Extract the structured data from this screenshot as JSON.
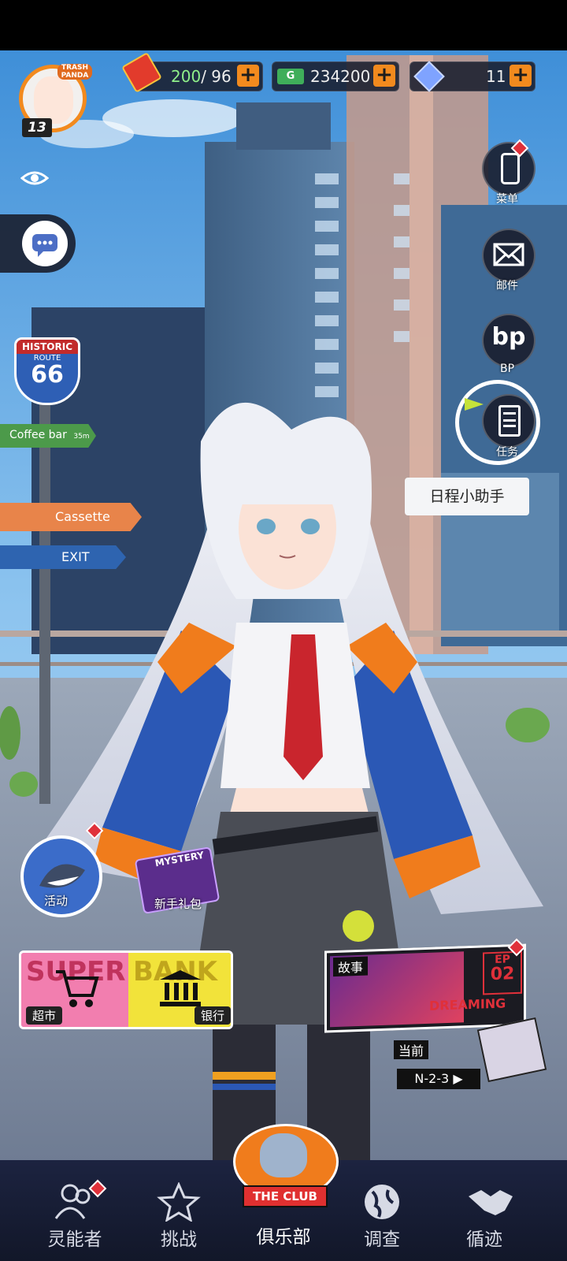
{
  "player": {
    "level": "13",
    "avatar_badge": "TRASH PANDA"
  },
  "resources": {
    "stamina_current": "200",
    "stamina_max": "96",
    "cash": "234200",
    "crystals": "11",
    "cash_icon_text": "G"
  },
  "side_menu": {
    "menu_label": "菜单",
    "mail_label": "邮件",
    "bp_label": "BP",
    "bp_icon_text": "bp",
    "tasks_label": "任务",
    "tooltip": "日程小助手"
  },
  "scenery": {
    "route_top": "HISTORIC",
    "route_mid": "ROUTE",
    "route_num": "66",
    "sign_coffee": "Coffee bar",
    "sign_coffee_sub": "35m",
    "sign_cassette": "Cassette",
    "sign_exit": "EXIT"
  },
  "events": {
    "activity_label": "活动",
    "newbie_pack_label": "新手礼包",
    "newbie_pack_tag": "MYSTERY",
    "supermarket_label": "超市",
    "bank_label": "银行",
    "supermarket_deco": "SUPER",
    "bank_deco": "BANK",
    "story_label": "故事",
    "story_episode": "EP",
    "story_episode_num": "02",
    "story_deco": "DREAMING",
    "current_label": "当前",
    "current_stage": "N-2-3"
  },
  "nav": {
    "items": [
      {
        "label": "灵能者"
      },
      {
        "label": "挑战"
      },
      {
        "label": "俱乐部"
      },
      {
        "label": "调查"
      },
      {
        "label": "循迹"
      }
    ],
    "club_logo_text": "THE CLUB"
  },
  "colors": {
    "accent_orange": "#f28a1e",
    "badge_red": "#e0303a",
    "sky_top": "#3f8fd8",
    "nav_bg": "#1c2340"
  }
}
